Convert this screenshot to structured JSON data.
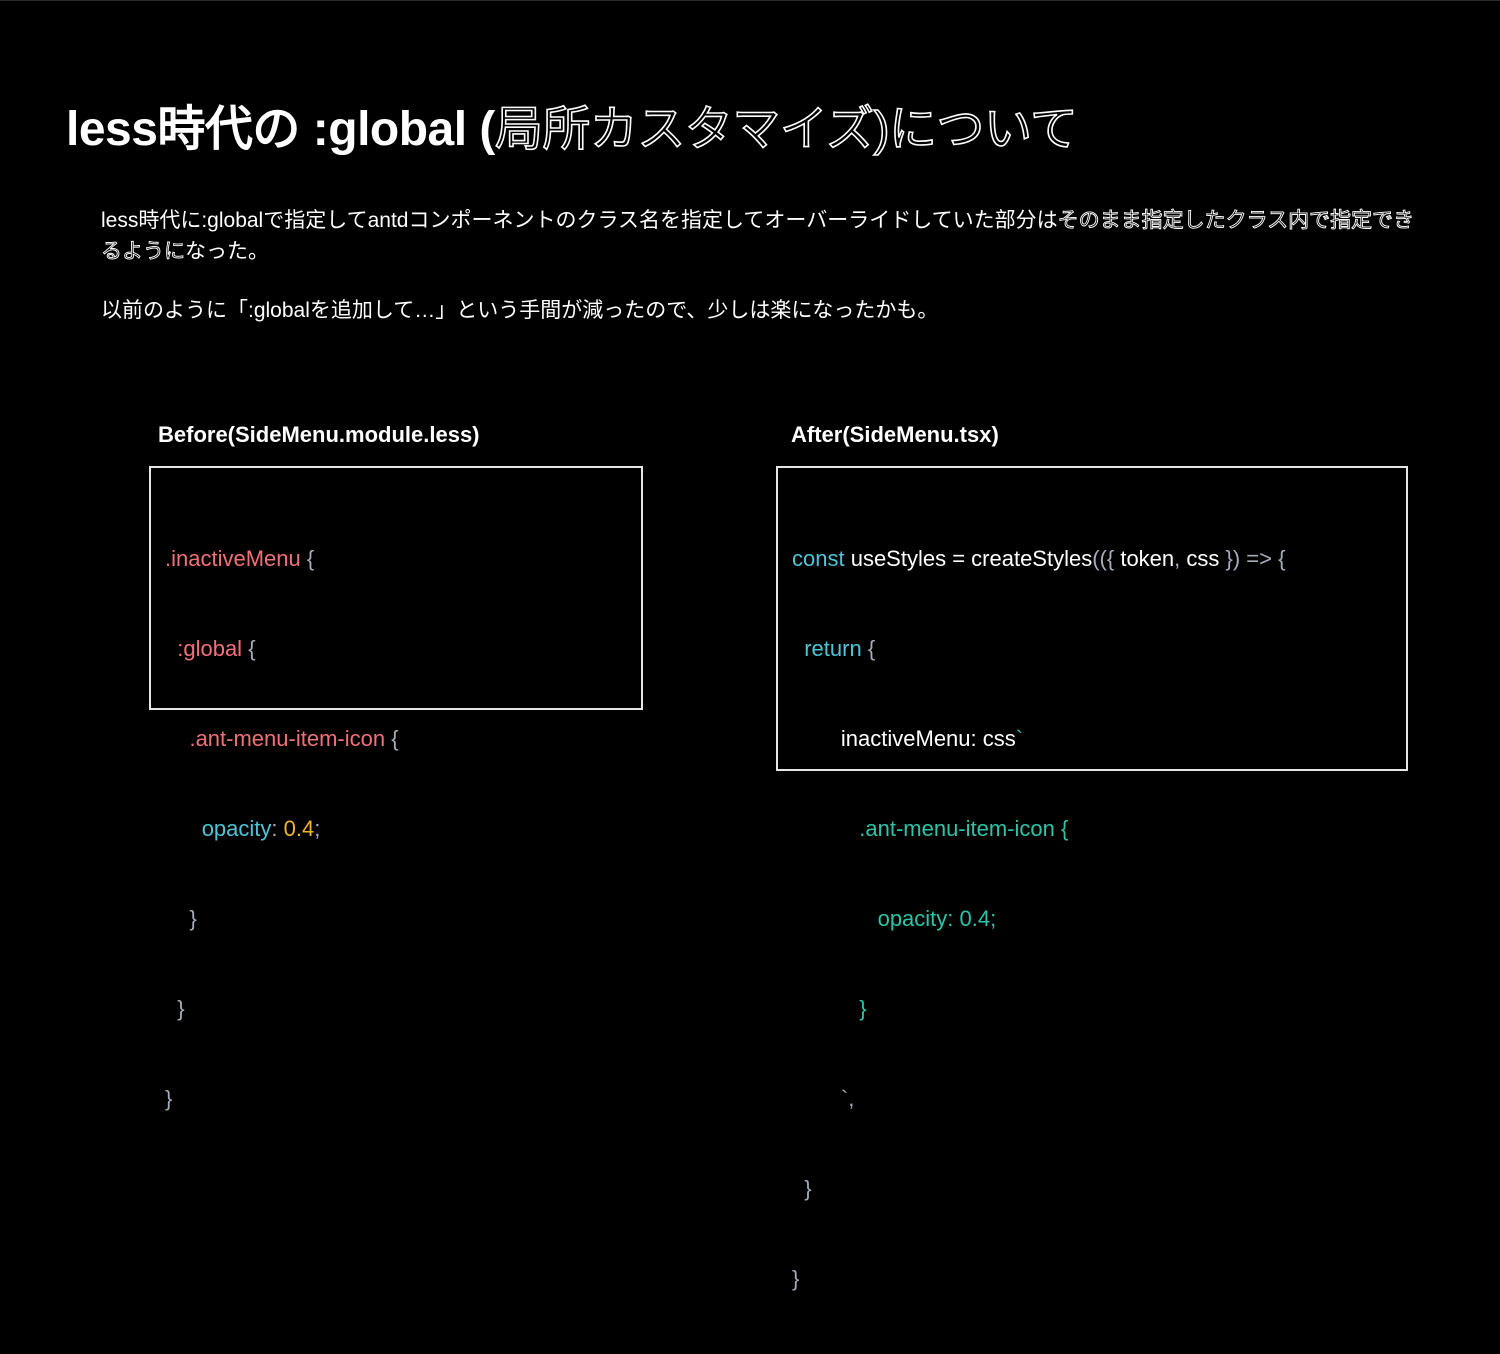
{
  "slide": {
    "title_main": "less時代の :global (",
    "title_outline": "局所カスタマイズ)について",
    "paragraph1_plain": "less時代に:globalで指定してantdコンポーネントのクラス名を指定してオーバーライドしていた部分は",
    "paragraph1_outline": "そのまま指定したクラス内で指定できるように",
    "paragraph1_tail": "なった。",
    "paragraph2": "以前のように「:globalを追加して…」という手間が減ったので、少しは楽になったかも。"
  },
  "before": {
    "heading": "Before(SideMenu.module.less)",
    "lines": [
      {
        "indent": "",
        "sel": ".inactiveMenu",
        "rest": " {"
      },
      {
        "indent": "  ",
        "sel": ":global",
        "rest": " {"
      },
      {
        "indent": "    ",
        "sel": ".ant-menu-item-icon",
        "rest": " {"
      },
      {
        "indent": "      ",
        "prop": "opacity",
        "colon": ": ",
        "num": "0.4",
        "semi": ";"
      },
      {
        "indent": "    ",
        "rest": "}"
      },
      {
        "indent": "  ",
        "rest": "}"
      },
      {
        "indent": "",
        "rest": "}"
      }
    ]
  },
  "after": {
    "heading": "After(SideMenu.tsx)",
    "line1_kw": "const",
    "line1_plain": " useStyles = createStyles",
    "line1_punc1": "(({",
    "line1_args": " token",
    "line1_comma": ",",
    "line1_args2": " css ",
    "line1_punc2": "}) => {",
    "line2_kw": "return",
    "line2_punc": " {",
    "line3_plain": "inactiveMenu: css",
    "line3_tick": "`",
    "line4_teal": ".ant-menu-item-icon {",
    "line5_teal": "opacity: 0.4;",
    "line6_teal": "}",
    "line7_punc": "`,",
    "line8_punc": "}",
    "line9_punc": "}"
  },
  "colors": {
    "background": "#000000",
    "selector": "#f07178",
    "punctuation": "#a6acb9",
    "property": "#4ec4d6",
    "number": "#f0b429",
    "teal": "#2cc4a8"
  }
}
